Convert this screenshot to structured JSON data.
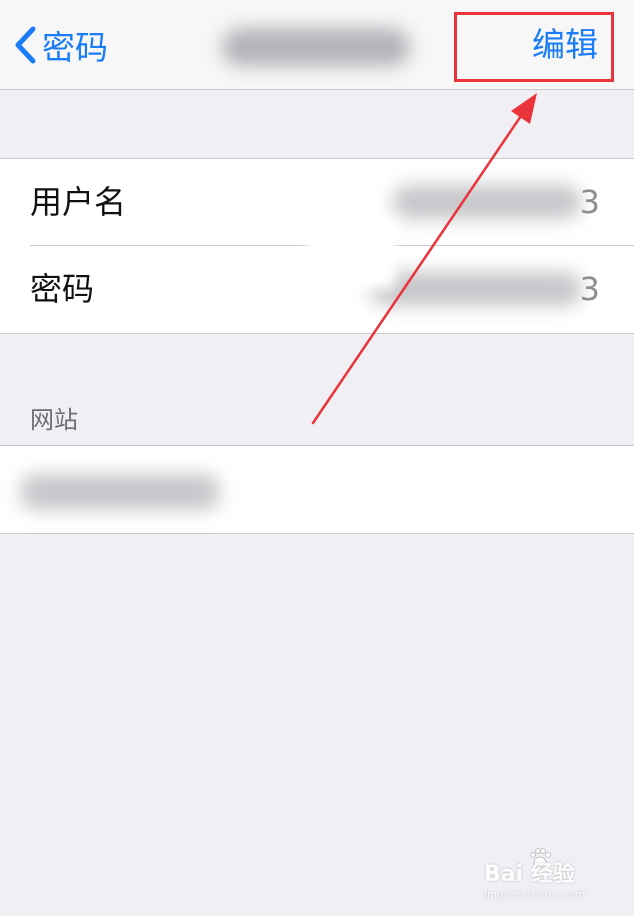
{
  "navbar": {
    "back_label": "密码",
    "edit_label": "编辑"
  },
  "credentials": {
    "rows": [
      {
        "label": "用户名",
        "suffix": "3"
      },
      {
        "label": "密码",
        "suffix": "3"
      }
    ]
  },
  "website_section": {
    "header": "网站"
  },
  "watermark": {
    "text": "Bai 经验",
    "url": "jingyan.baidu.com"
  },
  "colors": {
    "accent": "#1a7cf6",
    "annotation": "#e8343a",
    "background": "#efeff4"
  },
  "icons": [
    "chevron-left-icon",
    "annotation-arrow-icon",
    "baidu-paw-icon"
  ]
}
